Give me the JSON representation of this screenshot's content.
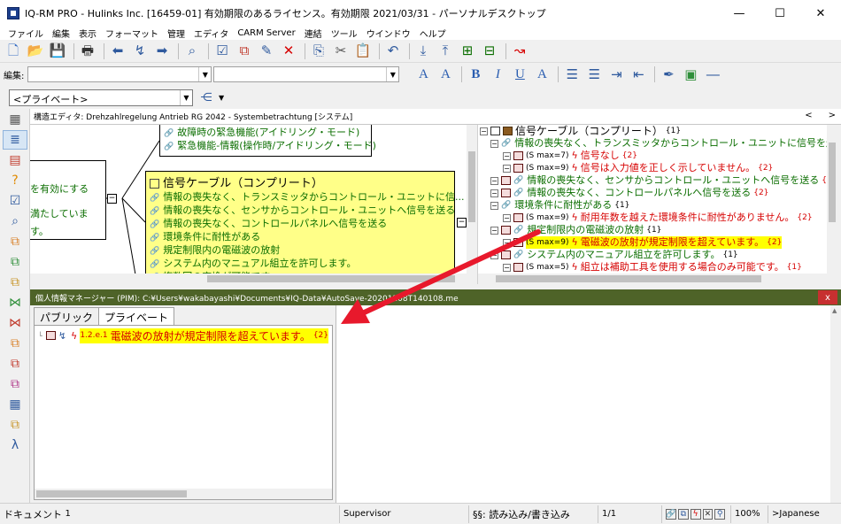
{
  "window": {
    "title": "IQ-RM PRO - Hulinks Inc. [16459-01] 有効期限のあるライセンス。有効期限 2021/03/31 - パーソナルデスクトップ",
    "minimize": "—",
    "maximize": "☐",
    "close": "✕"
  },
  "menu": {
    "items": [
      "ファイル",
      "編集",
      "表示",
      "フォーマット",
      "管理",
      "エディタ",
      "CARM Server",
      "連結",
      "ツール",
      "ウインドウ",
      "ヘルプ"
    ]
  },
  "format_toolbar": {
    "edit_label": "編集:",
    "buttons": [
      "A",
      "A",
      "B",
      "I",
      "U",
      "A"
    ]
  },
  "view_combo": {
    "value": "<プライベート>"
  },
  "structure_editor": {
    "header": "構造エディタ: Drehzahlregelung Antrieb RG 2042 - Systembetrachtung [システム]",
    "nav_prev": "<",
    "nav_next": ">",
    "top_node_lines": [
      "故障時の緊急機能(アイドリング・モード)",
      "緊急機能-情報(操作時/アイドリング・モード)"
    ],
    "left_node_lines": [
      "を有効にする",
      "満たしています。"
    ],
    "main_node": {
      "title": "信号ケーブル（コンプリート）",
      "lines": [
        "情報の喪失なく、トランスミッタからコントロール・ユニットに信...",
        "情報の喪失なく、センサからコントロール・ユニットへ信号を送る",
        "情報の喪失なく、コントロールパネルへ信号を送る",
        "環境条件に耐性がある",
        "規定制限内の電磁波の放射",
        "システム内のマニュアル組立を許可します。",
        "複数回の交換が可能です。"
      ]
    }
  },
  "tree": {
    "rows": [
      {
        "text": "信号ケーブル（コンプリート）",
        "tag": "{1}",
        "kind": "component"
      },
      {
        "text": "情報の喪失なく、トランスミッタからコントロール・ユニットに信号を送る",
        "tag": "",
        "kind": "function"
      },
      {
        "smax": "(S max=7)",
        "text": "信号なし",
        "tag": "{2}",
        "kind": "failure"
      },
      {
        "smax": "(S max=9)",
        "text": "信号は入力値を正しく示していません。",
        "tag": "{2}",
        "kind": "failure"
      },
      {
        "text": "情報の喪失なく、センサからコントロール・ユニットへ信号を送る",
        "tag": "{2}",
        "kind": "function"
      },
      {
        "text": "情報の喪失なく、コントロールパネルへ信号を送る",
        "tag": "{2}",
        "kind": "function"
      },
      {
        "text": "環境条件に耐性がある",
        "tag": "{1}",
        "kind": "function"
      },
      {
        "smax": "(S max=9)",
        "text": "耐用年数を越えた環境条件に耐性がありません。",
        "tag": "{2}",
        "kind": "failure"
      },
      {
        "text": "規定制限内の電磁波の放射",
        "tag": "{1}",
        "kind": "function"
      },
      {
        "smax": "(S max=9)",
        "text": "電磁波の放射が規定制限を超えています。",
        "tag": "{2}",
        "kind": "failure-highlight"
      },
      {
        "text": "システム内のマニュアル組立を許可します。",
        "tag": "{1}",
        "kind": "function"
      },
      {
        "smax": "(S max=5)",
        "text": "組立は補助工具を使用する場合のみ可能です。",
        "tag": "{1}",
        "kind": "failure"
      }
    ]
  },
  "pim": {
    "title": "個人情報マネージャー (PIM): C:¥Users¥wakabayashi¥Documents¥IQ-Data¥AutoSave-20201208T140108.me",
    "close": "x",
    "tabs": [
      "パブリック",
      "プライベート"
    ],
    "item": {
      "id": "1.2.e.1",
      "text": "電磁波の放射が規定制限を超えています。",
      "tag": "{2}"
    }
  },
  "status": {
    "document": "ドキュメント",
    "document_count": "1",
    "user": "Supervisor",
    "mode": "§§: 読み込み/書き込み",
    "page": "1/1",
    "zoom": "100%",
    "language": ">Japanese"
  },
  "colors": {
    "function_green": "#0b6e00",
    "failure_red": "#d60000",
    "highlight_yellow": "#ffff00",
    "node_yellow": "#ffff88",
    "pim_bar": "#4e6328",
    "arrow_red": "#e8192c"
  }
}
